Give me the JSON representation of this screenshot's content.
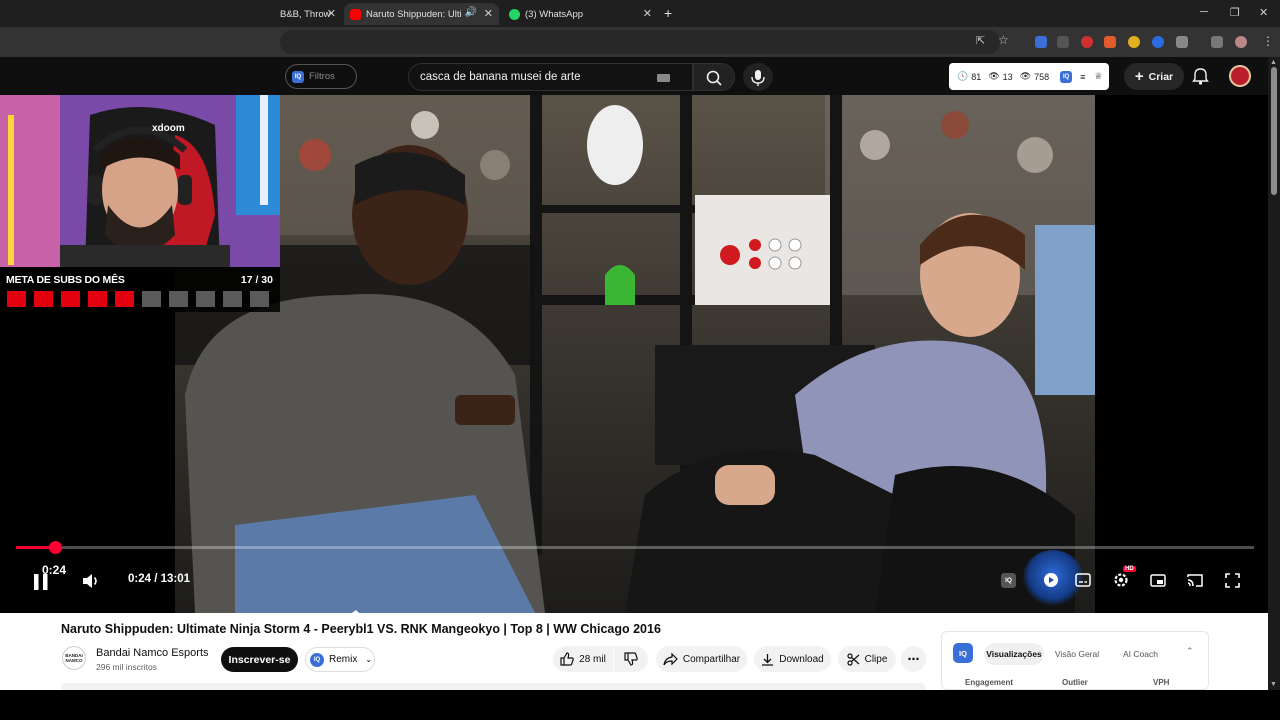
{
  "browser": {
    "tabs": [
      {
        "label": "B&B, Throw",
        "icon": "partial-tab-favicon"
      },
      {
        "label": "Naruto Shippuden: Ultimate",
        "icon": "youtube-icon"
      },
      {
        "label": "(3) WhatsApp",
        "icon": "whatsapp-icon"
      }
    ],
    "new_tab": "+"
  },
  "stream_overlay": {
    "goal_label": "META DE SUBS DO MÊS",
    "goal_count": "17 / 30",
    "goal_filled": 5,
    "goal_total": 10,
    "webcam_brand": "xdoom"
  },
  "youtube_header": {
    "filters_label": "Filtros",
    "search_value": "casca de banana musei de arte",
    "stats": {
      "a": "81",
      "b": "13",
      "c": "758"
    },
    "create_label": "Criar"
  },
  "player": {
    "hover_time": "0:24",
    "time_display": "0:24 / 13:01",
    "progress_fraction": 0.0307,
    "hd_badge": "HD",
    "iq_badge": "IQ"
  },
  "video": {
    "title": "Naruto Shippuden: Ultimate Ninja Storm 4 - Peerybl1 VS. RNK Mangeokyo | Top 8 | WW Chicago 2016",
    "channel_name": "Bandai Namco Esports",
    "channel_subs": "296 mil inscritos",
    "channel_logo_text": "BANDAI NAMCO",
    "subscribe_label": "Inscrever-se",
    "remix_label": "Remix",
    "likes": "28 mil",
    "share_label": "Compartilhar",
    "download_label": "Download",
    "clip_label": "Clipe"
  },
  "analytics_panel": {
    "badge": "IQ",
    "tabs": [
      "Visualizações",
      "Visão Geral",
      "AI Coach"
    ],
    "columns": [
      "Engagement",
      "Outlier",
      "VPH"
    ]
  },
  "colors": {
    "accent": "#ff0033",
    "goal_filled": "#e3000f",
    "goal_empty": "#5a5a5a",
    "iq_blue": "#3b6fd8"
  }
}
